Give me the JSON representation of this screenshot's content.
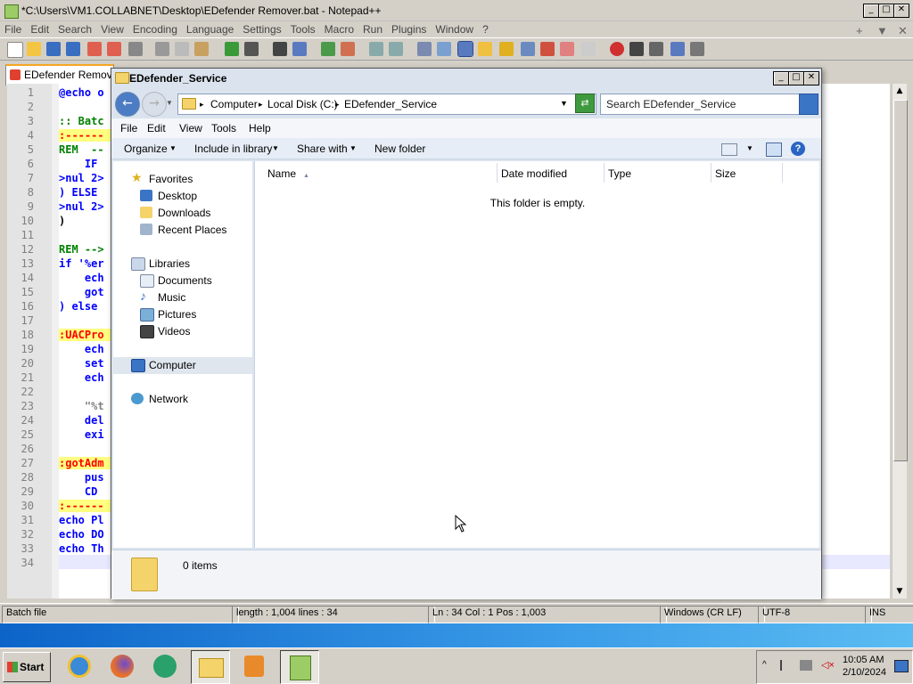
{
  "npp": {
    "title": "*C:\\Users\\VM1.COLLABNET\\Desktop\\EDefender Remover.bat - Notepad++",
    "menu": [
      "File",
      "Edit",
      "Search",
      "View",
      "Encoding",
      "Language",
      "Settings",
      "Tools",
      "Macro",
      "Run",
      "Plugins",
      "Window",
      "?"
    ],
    "menu_right": [
      "+",
      "▼",
      "✕"
    ],
    "tab_label": "EDefender Remover",
    "lines": [
      {
        "n": "1",
        "code": "@echo o",
        "color": "#0000ff"
      },
      {
        "n": "2",
        "code": "",
        "color": "#000"
      },
      {
        "n": "3",
        "code": ":: Batc",
        "color": "#008000"
      },
      {
        "n": "4",
        "code": ":------",
        "color": "#ff0000"
      },
      {
        "n": "5",
        "code": "REM  --",
        "color": "#008000"
      },
      {
        "n": "6",
        "code": "    IF",
        "color": "#0000ff"
      },
      {
        "n": "7",
        "code": ">nul 2>",
        "color": "#0000ff"
      },
      {
        "n": "8",
        "code": ") ELSE",
        "color": "#0000ff"
      },
      {
        "n": "9",
        "code": ">nul 2>",
        "color": "#0000ff"
      },
      {
        "n": "10",
        "code": ")",
        "color": "#000"
      },
      {
        "n": "11",
        "code": "",
        "color": "#000"
      },
      {
        "n": "12",
        "code": "REM -->",
        "color": "#008000"
      },
      {
        "n": "13",
        "code": "if '%er",
        "color": "#0000ff"
      },
      {
        "n": "14",
        "code": "    ech",
        "color": "#0000ff"
      },
      {
        "n": "15",
        "code": "    got",
        "color": "#0000ff"
      },
      {
        "n": "16",
        "code": ") else",
        "color": "#0000ff"
      },
      {
        "n": "17",
        "code": "",
        "color": "#000"
      },
      {
        "n": "18",
        "code": ":UACPro",
        "color": "#ff0000"
      },
      {
        "n": "19",
        "code": "    ech",
        "color": "#0000ff"
      },
      {
        "n": "20",
        "code": "    set",
        "color": "#0000ff"
      },
      {
        "n": "21",
        "code": "    ech",
        "color": "#0000ff"
      },
      {
        "n": "22",
        "code": "",
        "color": "#000"
      },
      {
        "n": "23",
        "code": "    \"%t",
        "color": "#808080"
      },
      {
        "n": "24",
        "code": "    del",
        "color": "#0000ff"
      },
      {
        "n": "25",
        "code": "    exi",
        "color": "#0000ff"
      },
      {
        "n": "26",
        "code": "",
        "color": "#000"
      },
      {
        "n": "27",
        "code": ":gotAdm",
        "color": "#ff0000"
      },
      {
        "n": "28",
        "code": "    pus",
        "color": "#0000ff"
      },
      {
        "n": "29",
        "code": "    CD",
        "color": "#0000ff"
      },
      {
        "n": "30",
        "code": ":------",
        "color": "#ff0000"
      },
      {
        "n": "31",
        "code": "echo Pl",
        "color": "#0000ff"
      },
      {
        "n": "32",
        "code": "echo DO",
        "color": "#0000ff"
      },
      {
        "n": "33",
        "code": "echo Th",
        "color": "#0000ff"
      },
      {
        "n": "34",
        "code": "",
        "color": "#000"
      }
    ],
    "status": {
      "type": "Batch file",
      "length": "length : 1,004    lines : 34",
      "pos": "Ln : 34    Col : 1    Pos : 1,003",
      "eol": "Windows (CR LF)",
      "enc": "UTF-8",
      "mode": "INS"
    }
  },
  "explorer": {
    "title": "EDefender_Service",
    "crumbs": [
      "Computer",
      "Local Disk (C:)",
      "EDefender_Service"
    ],
    "search_placeholder": "Search EDefender_Service",
    "menu": [
      "File",
      "Edit",
      "View",
      "Tools",
      "Help"
    ],
    "commands": {
      "organize": "Organize",
      "include": "Include in library",
      "share": "Share with",
      "newfolder": "New folder"
    },
    "columns": {
      "name": "Name",
      "date": "Date modified",
      "type": "Type",
      "size": "Size"
    },
    "empty": "This folder is empty.",
    "nav": {
      "favorites": "Favorites",
      "desktop": "Desktop",
      "downloads": "Downloads",
      "recent": "Recent Places",
      "libraries": "Libraries",
      "documents": "Documents",
      "music": "Music",
      "pictures": "Pictures",
      "videos": "Videos",
      "computer": "Computer",
      "network": "Network"
    },
    "details": "0 items"
  },
  "taskbar": {
    "start": "Start",
    "time": "10:05 AM",
    "date": "2/10/2024"
  }
}
